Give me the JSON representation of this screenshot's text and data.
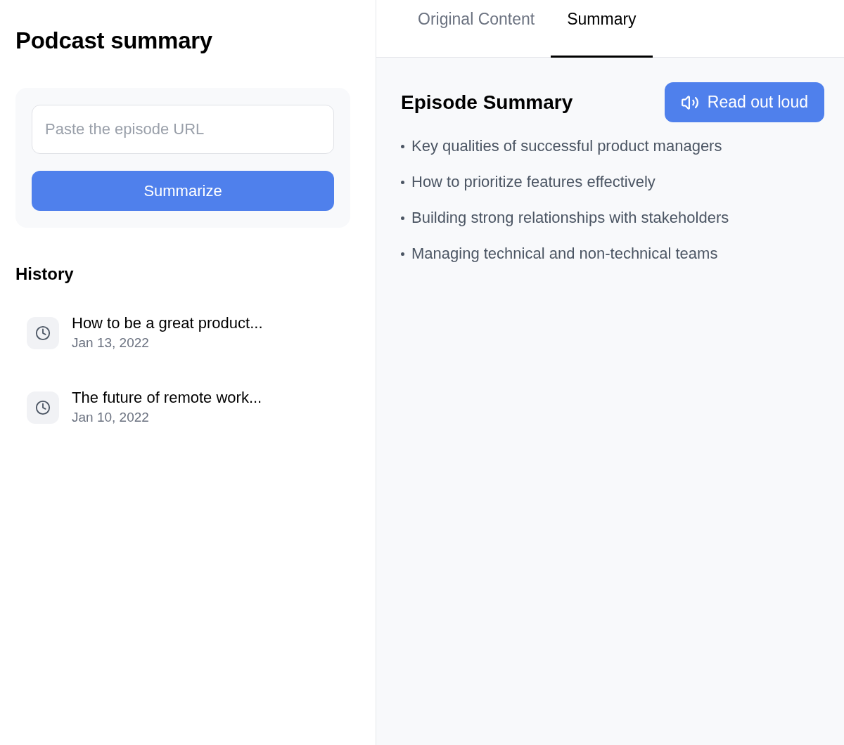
{
  "app": {
    "title": "Podcast summary"
  },
  "url_form": {
    "placeholder": "Paste the episode URL",
    "button": "Summarize"
  },
  "history": {
    "heading": "History",
    "items": [
      {
        "title": "How to be a great product...",
        "date": "Jan 13, 2022"
      },
      {
        "title": "The future of remote work...",
        "date": "Jan 10, 2022"
      }
    ]
  },
  "tabs": [
    {
      "label": "Original Content",
      "selected": false
    },
    {
      "label": "Summary",
      "selected": true
    }
  ],
  "summary": {
    "heading": "Episode Summary",
    "read_button": "Read out loud",
    "points": [
      "Key qualities of successful product managers",
      "How to prioritize features effectively",
      "Building strong relationships with stakeholders",
      "Managing technical and non-technical teams"
    ]
  }
}
